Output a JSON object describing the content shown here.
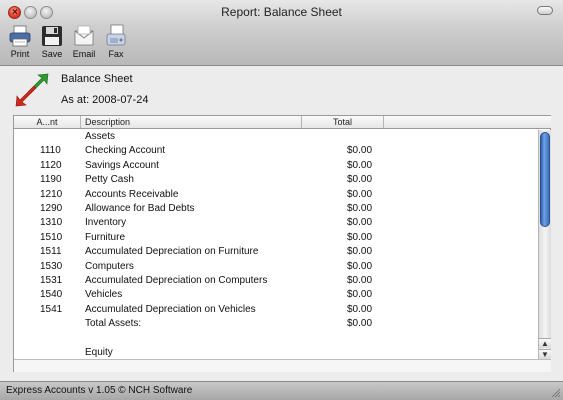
{
  "window": {
    "title": "Report: Balance Sheet"
  },
  "toolbar": {
    "items": [
      {
        "label": "Print",
        "icon": "print-icon"
      },
      {
        "label": "Save",
        "icon": "save-icon"
      },
      {
        "label": "Email",
        "icon": "email-icon"
      },
      {
        "label": "Fax",
        "icon": "fax-icon"
      }
    ]
  },
  "report": {
    "title": "Balance Sheet",
    "date_line": "As at: 2008-07-24"
  },
  "table": {
    "columns": [
      "A...nt",
      "Description",
      "Total"
    ],
    "rows": [
      {
        "account": "",
        "description": "Assets",
        "total": ""
      },
      {
        "account": "1110",
        "description": "Checking Account",
        "total": "$0.00"
      },
      {
        "account": "1120",
        "description": "Savings Account",
        "total": "$0.00"
      },
      {
        "account": "1190",
        "description": "Petty Cash",
        "total": "$0.00"
      },
      {
        "account": "1210",
        "description": "Accounts Receivable",
        "total": "$0.00"
      },
      {
        "account": "1290",
        "description": "Allowance for Bad Debts",
        "total": "$0.00"
      },
      {
        "account": "1310",
        "description": "Inventory",
        "total": "$0.00"
      },
      {
        "account": "1510",
        "description": "Furniture",
        "total": "$0.00"
      },
      {
        "account": "1511",
        "description": "Accumulated Depreciation on Furniture",
        "total": "$0.00"
      },
      {
        "account": "1530",
        "description": "Computers",
        "total": "$0.00"
      },
      {
        "account": "1531",
        "description": "Accumulated Depreciation on Computers",
        "total": "$0.00"
      },
      {
        "account": "1540",
        "description": "Vehicles",
        "total": "$0.00"
      },
      {
        "account": "1541",
        "description": "Accumulated Depreciation on Vehicles",
        "total": "$0.00"
      },
      {
        "account": "",
        "description": "Total Assets:",
        "total": "$0.00"
      },
      {
        "account": "",
        "description": "",
        "total": ""
      },
      {
        "account": "",
        "description": "Equity",
        "total": ""
      }
    ]
  },
  "statusbar": {
    "text": "Express Accounts v 1.05 © NCH Software"
  },
  "colors": {
    "scroll_thumb": "#3a6fbe",
    "report_icon_green": "#2f9a2f",
    "report_icon_red": "#cc2a1c"
  }
}
